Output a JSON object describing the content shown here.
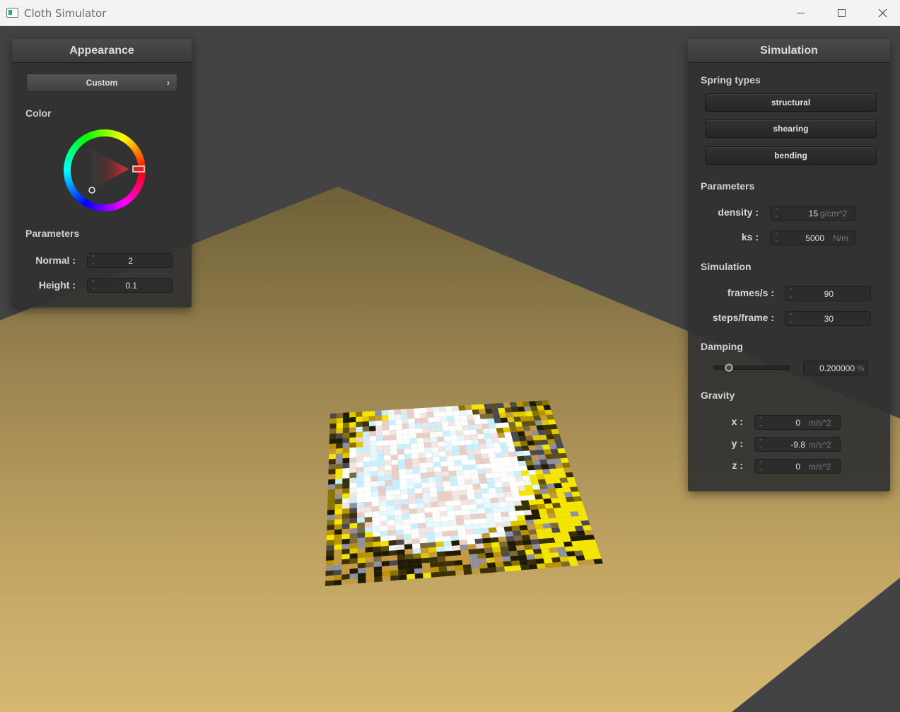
{
  "window": {
    "title": "Cloth Simulator"
  },
  "appearance_panel": {
    "title": "Appearance",
    "shader_button": "Custom",
    "color_label": "Color",
    "parameters_label": "Parameters",
    "normal_label": "Normal :",
    "normal_value": "2",
    "height_label": "Height :",
    "height_value": "0.1"
  },
  "simulation_panel": {
    "title": "Simulation",
    "spring_types_label": "Spring types",
    "spring_buttons": [
      "structural",
      "shearing",
      "bending"
    ],
    "parameters_label": "Parameters",
    "density_label": "density :",
    "density_value": "15",
    "density_unit": "g/cm^2",
    "ks_label": "ks :",
    "ks_value": "5000",
    "ks_unit": "N/m",
    "simulation_label": "Simulation",
    "fps_label": "frames/s :",
    "fps_value": "90",
    "steps_label": "steps/frame :",
    "steps_value": "30",
    "damping_label": "Damping",
    "damping_value": "0.200000",
    "damping_unit": "%",
    "damping_fraction": 0.2,
    "gravity_label": "Gravity",
    "gravity_x_label": "x :",
    "gravity_x_value": "0",
    "gravity_y_label": "y :",
    "gravity_y_value": "-9.8",
    "gravity_z_label": "z :",
    "gravity_z_value": "0",
    "gravity_unit": "m/s^2"
  },
  "colors": {
    "floor": "#b89a55",
    "background": "#434345",
    "selected_color": "#e52222"
  }
}
